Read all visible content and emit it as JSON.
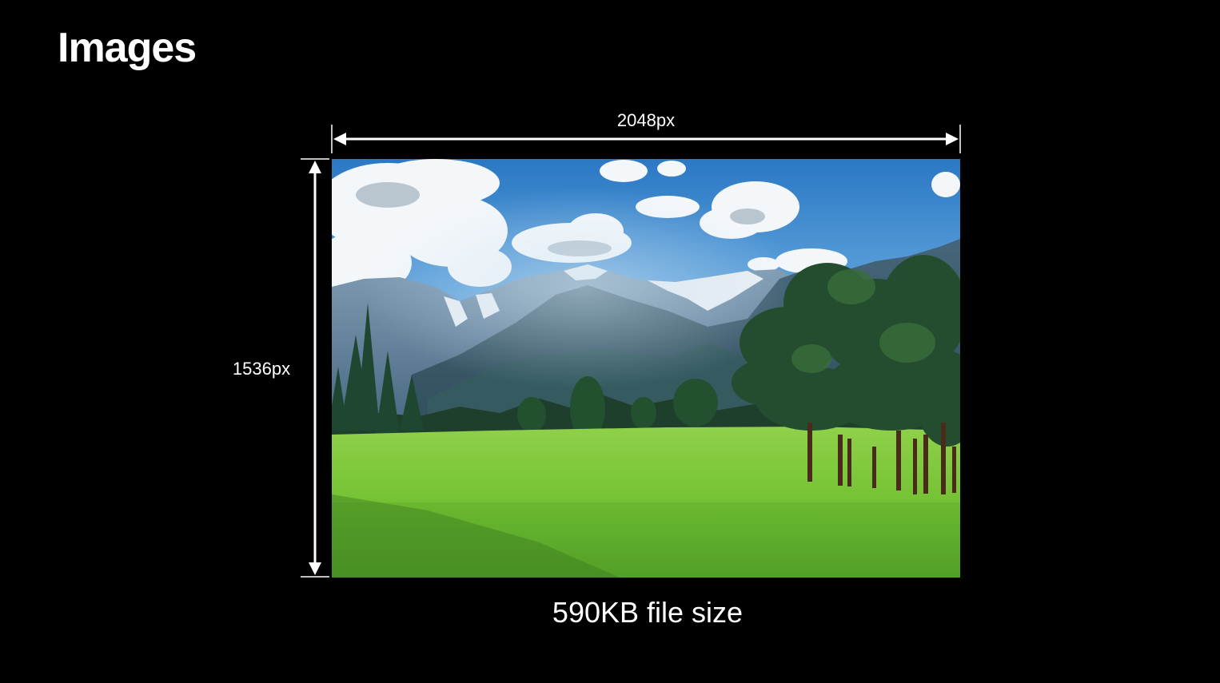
{
  "slide": {
    "title": "Images",
    "width_label": "2048px",
    "height_label": "1536px",
    "caption": "590KB file size"
  },
  "colors": {
    "background": "#000000",
    "text": "#ffffff",
    "sky": "#2f7fc9",
    "grass": "#7bc93a",
    "trees": "#1f4a2c",
    "mountains": "#4f6f86"
  },
  "photo": {
    "subject": "mountain-meadow-landscape"
  }
}
